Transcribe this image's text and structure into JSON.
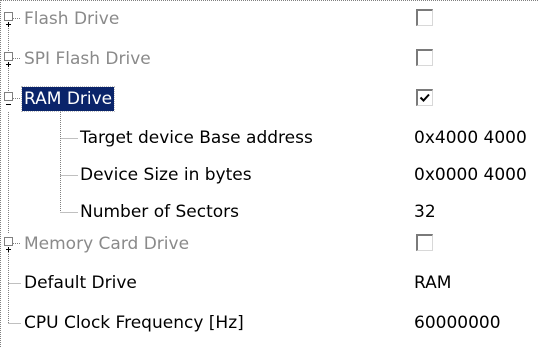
{
  "tree": {
    "nodes": [
      {
        "label": "Flash Drive",
        "expander": "+",
        "checked": false,
        "state": "disabled"
      },
      {
        "label": "SPI Flash Drive",
        "expander": "+",
        "checked": false,
        "state": "disabled"
      },
      {
        "label": "RAM Drive",
        "expander": "-",
        "checked": true,
        "state": "selected"
      },
      {
        "label": "Target device Base address",
        "value": "0x4000 4000"
      },
      {
        "label": "Device Size in bytes",
        "value": "0x0000 4000"
      },
      {
        "label": "Number of Sectors",
        "value": "32"
      },
      {
        "label": "Memory Card Drive",
        "expander": "+",
        "checked": false,
        "state": "disabled"
      },
      {
        "label": "Default Drive",
        "value": "RAM"
      },
      {
        "label": "CPU Clock Frequency [Hz]",
        "value": "60000000"
      }
    ]
  },
  "colors": {
    "selection_background": "#0a246a",
    "disabled_text": "#8a8a8a",
    "tree_lines": "#808080"
  },
  "icons": {
    "expand": "plus-box-icon",
    "collapse": "minus-box-icon",
    "check": "checkmark-icon"
  }
}
